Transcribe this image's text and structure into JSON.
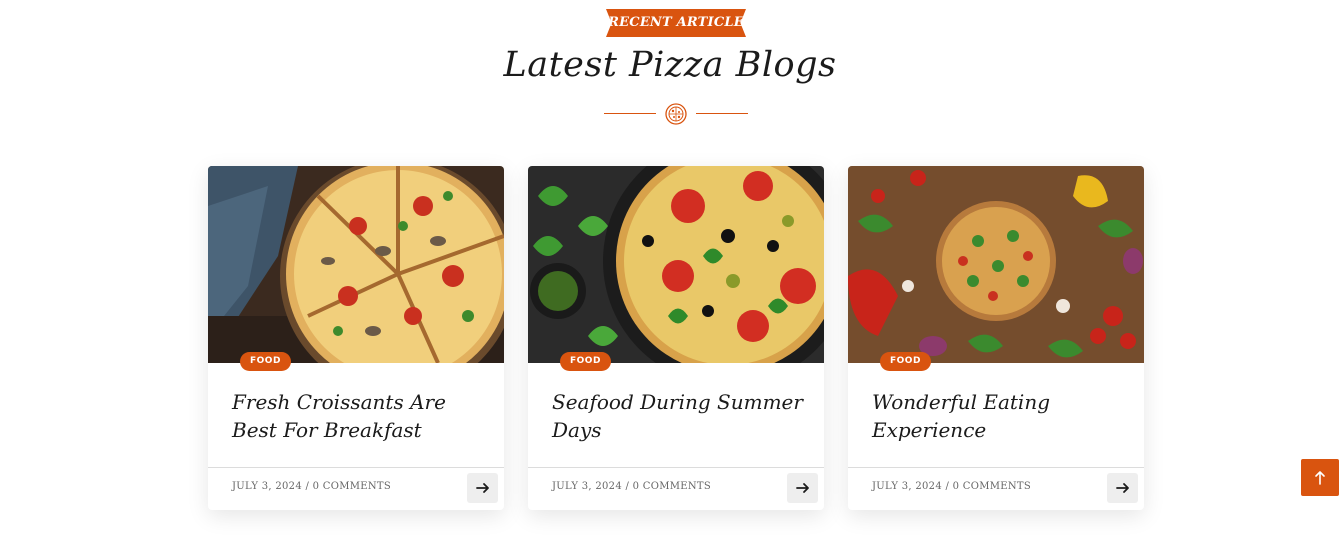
{
  "section": {
    "eyebrow": "RECENT ARTICLE",
    "title": "Latest Pizza Blogs",
    "divider_icon": "pizza-icon"
  },
  "colors": {
    "accent": "#d9540f",
    "text": "#1b1b1b",
    "muted": "#666666"
  },
  "posts": [
    {
      "category": "FOOD",
      "title": "Fresh Croissants Are Best For Breakfast",
      "meta": "JULY 3, 2024 / 0 COMMENTS",
      "image": "pizza-slices-photo"
    },
    {
      "category": "FOOD",
      "title": "Seafood During Summer Days",
      "meta": "JULY 3, 2024 / 0 COMMENTS",
      "image": "tomato-basil-pizza-photo"
    },
    {
      "category": "FOOD",
      "title": "Wonderful Eating Experience",
      "meta": "JULY 3, 2024 / 0 COMMENTS",
      "image": "pizza-on-table-photo"
    }
  ],
  "icons": {
    "read_more": "arrow-right-icon",
    "scroll_top": "arrow-up-icon"
  }
}
